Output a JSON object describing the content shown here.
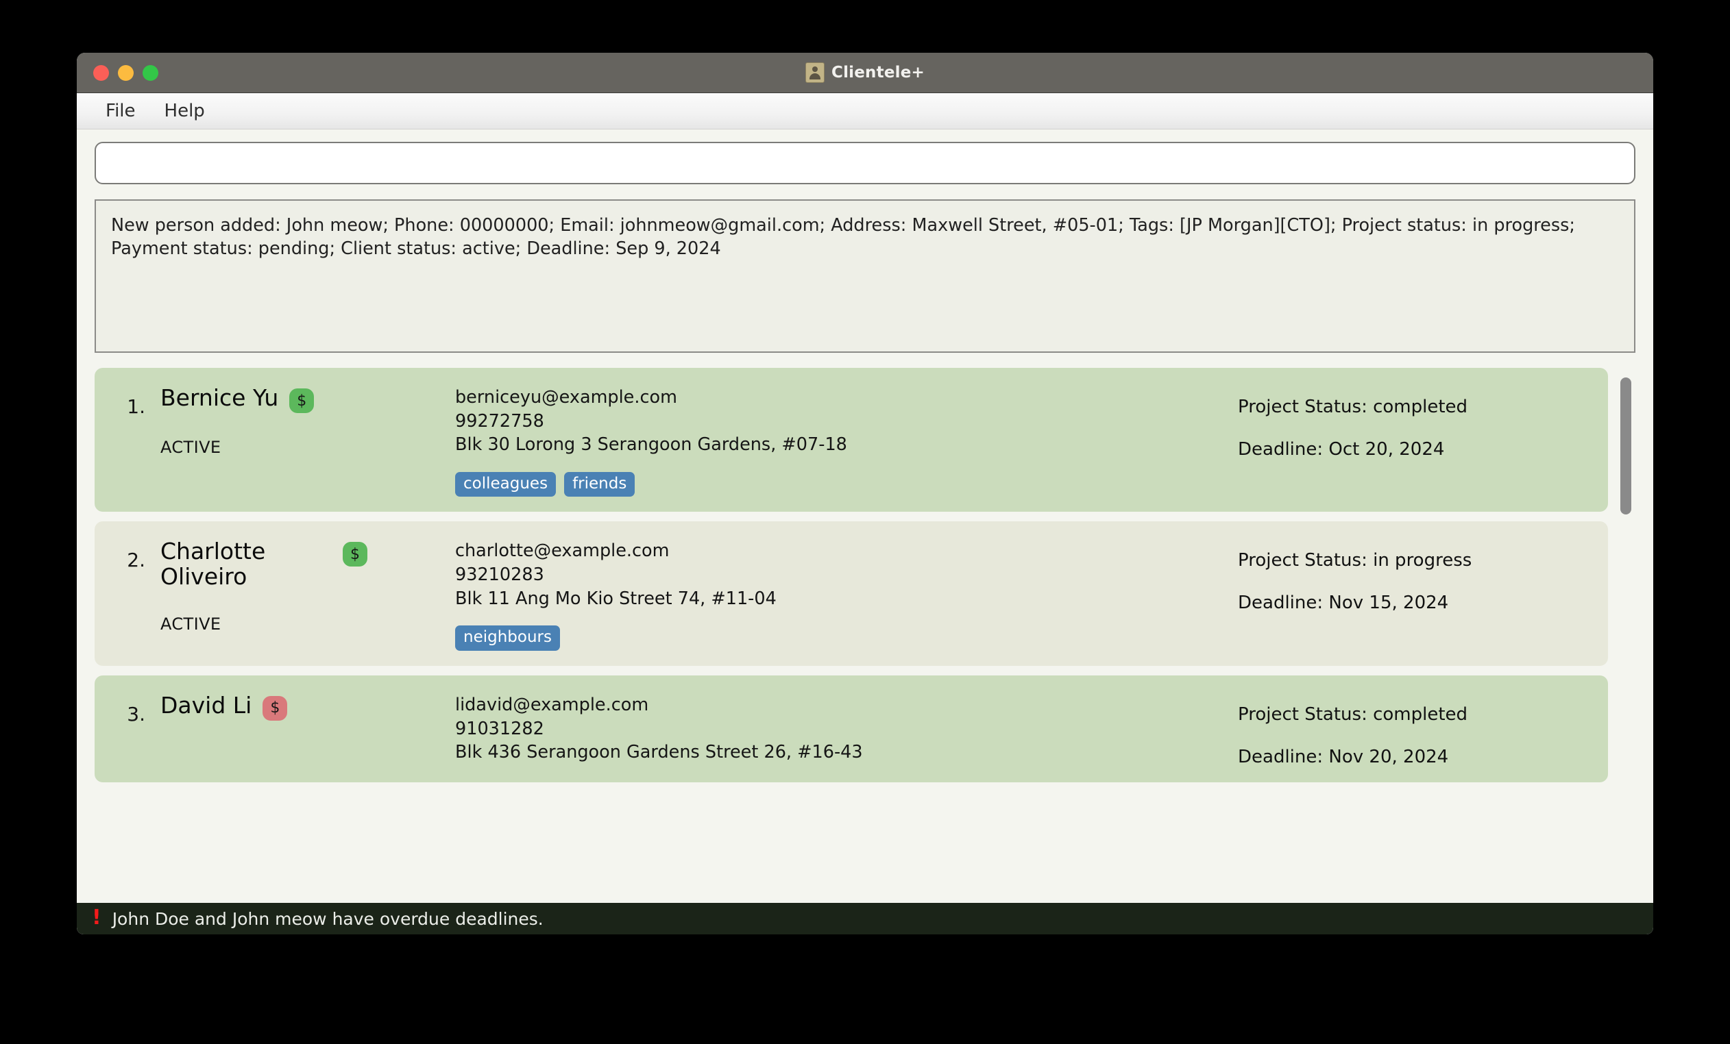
{
  "window": {
    "title": "Clientele+",
    "title_icon": "address-book-icon",
    "traffic_lights": [
      "close",
      "minimize",
      "maximize"
    ]
  },
  "menubar": {
    "items": [
      {
        "label": "File"
      },
      {
        "label": "Help"
      }
    ]
  },
  "command_input": {
    "value": "",
    "placeholder": ""
  },
  "result_display": {
    "text": "New person added: John meow; Phone: 00000000; Email: johnmeow@gmail.com; Address: Maxwell Street, #05-01; Tags: [JP Morgan][CTO]; Project status: in progress; Payment status: pending; Client status: active; Deadline: Sep 9, 2024"
  },
  "person_list": {
    "people": [
      {
        "index": "1.",
        "name": "Bernice Yu",
        "payment_badge": "$",
        "payment_state": "paid",
        "client_status": "ACTIVE",
        "email": "berniceyu@example.com",
        "phone": "99272758",
        "address": "Blk 30 Lorong 3 Serangoon Gardens, #07-18",
        "tags": [
          "colleagues",
          "friends"
        ],
        "project_status": "Project Status: completed",
        "deadline": "Deadline: Oct 20, 2024"
      },
      {
        "index": "2.",
        "name": "Charlotte Oliveiro",
        "payment_badge": "$",
        "payment_state": "paid",
        "client_status": "ACTIVE",
        "email": "charlotte@example.com",
        "phone": "93210283",
        "address": "Blk 11 Ang Mo Kio Street 74, #11-04",
        "tags": [
          "neighbours"
        ],
        "project_status": "Project Status: in progress",
        "deadline": "Deadline: Nov 15, 2024"
      },
      {
        "index": "3.",
        "name": "David Li",
        "payment_badge": "$",
        "payment_state": "unpaid",
        "client_status": "",
        "email": "lidavid@example.com",
        "phone": "91031282",
        "address": "Blk 436 Serangoon Gardens Street 26, #16-43",
        "tags": [],
        "project_status": "Project Status: completed",
        "deadline": "Deadline: Nov 20, 2024"
      }
    ]
  },
  "statusbar": {
    "warn_icon": "exclamation-icon",
    "message": "John Doe and John meow have overdue deadlines."
  },
  "colors": {
    "titlebar": "#66645f",
    "card_green": "#cbdcbc",
    "card_beige": "#e7e8da",
    "tag_blue": "#4a81b4",
    "badge_paid": "#5cb85c",
    "badge_unpaid": "#d9797b",
    "statusbar_bg": "#1b2418",
    "warn_red": "#f31b1b"
  }
}
